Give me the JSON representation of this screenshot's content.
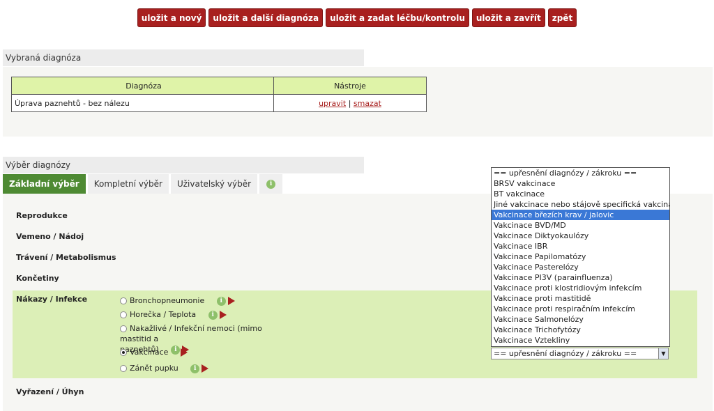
{
  "toolbar": {
    "buttons": [
      "uložit a nový",
      "uložit a další diagnóza",
      "uložit a zadat léčbu/kontrolu",
      "uložit a zavřít",
      "zpět"
    ]
  },
  "selected_diagnosis": {
    "title": "Vybraná diagnóza",
    "columns": [
      "Diagnóza",
      "Nástroje"
    ],
    "rows": [
      {
        "diagnosis": "Úprava paznehtů - bez nálezu",
        "edit": "upravit",
        "separator": "|",
        "delete": "smazat"
      }
    ]
  },
  "diagnosis_selection": {
    "title": "Výběr diagnózy",
    "tabs": [
      "Základní výběr",
      "Kompletní výběr",
      "Uživatelský výběr"
    ],
    "categories": [
      "Reprodukce",
      "Vemeno / Nádoj",
      "Trávení / Metabolismus",
      "Končetiny",
      "Nákazy / Infekce",
      "Vyřazení / Úhyn"
    ],
    "options": [
      {
        "label": "Bronchopneumonie",
        "checked": false
      },
      {
        "label": "Horečka / Teplota",
        "checked": false
      },
      {
        "label": "Nakažlivé / Infekční nemoci (mimo mastitid a",
        "label2": "paznehtů)",
        "checked": false
      },
      {
        "label": "Vakcinace",
        "checked": true
      },
      {
        "label": "Zánět pupku",
        "checked": false
      }
    ]
  },
  "refinement": {
    "selected": "== upřesnění diagnózy / zákroku ==",
    "highlighted_index": 4,
    "options": [
      "== upřesnění diagnózy / zákroku ==",
      "BRSV vakcinace",
      "BT vakcinace",
      "Jiné vakcinace nebo stájově specifická vakcinace",
      "Vakcinace březích krav / jalovic",
      "Vakcinace BVD/MD",
      "Vakcinace Diktyokaulózy",
      "Vakcinace IBR",
      "Vakcinace Papilomatózy",
      "Vakcinace Pasterelózy",
      "Vakcinace PI3V (parainfluenza)",
      "Vakcinace proti klostridiovým infekcím",
      "Vakcinace proti mastitidě",
      "Vakcinace proti respiračním infekcím",
      "Vakcinace Salmonelózy",
      "Vakcinace Trichofytózy",
      "Vakcinace Vztekliny"
    ]
  }
}
